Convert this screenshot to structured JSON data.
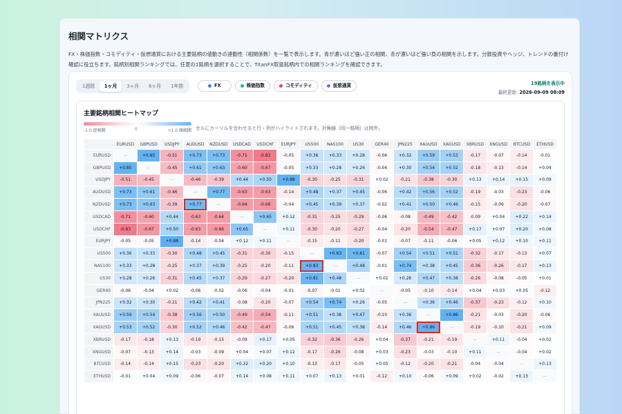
{
  "page": {
    "title": "相関マトリクス",
    "description": "FX・株価指数・コモディティ・仮想通貨における主要銘柄の値動きの連動性（相関係数）を一覧で表示します。青が濃いほど強い正の相関、赤が濃いほど強い負の相関を示します。分散投資やヘッジ、トレンドの裏付け確認に役立ちます。銘柄別相関ランキングでは、任意の1銘柄を選択することで、TitanFX取扱銘柄内での相関ランキングを確認できます。"
  },
  "periods": [
    {
      "label": "1週間",
      "active": false
    },
    {
      "label": "1ヶ月",
      "active": true
    },
    {
      "label": "3ヶ月",
      "active": false
    },
    {
      "label": "6ヶ月",
      "active": false
    },
    {
      "label": "1年間",
      "active": false
    }
  ],
  "categories": [
    {
      "label": "FX",
      "color": "#3b82f6"
    },
    {
      "label": "株価指数",
      "color": "#14b8a6"
    },
    {
      "label": "コモディティ",
      "color": "#ef4444"
    },
    {
      "label": "仮想通貨",
      "color": "#8b5cf6"
    }
  ],
  "meta": {
    "shown": "19銘柄を表示中",
    "updated_label": "最終更新:",
    "updated_value": "2026-09-09 08:09"
  },
  "heatmap": {
    "title": "主要銘柄相関ヒートマップ",
    "scale_min": "-1.0 逆相関",
    "scale_mid": "0",
    "scale_max": "+1.0 順相関",
    "hint": "セルにカーソルを合わせると行・列がハイライトされます。対角線（同一銘柄）は除外。",
    "diag": "—"
  },
  "chart_data": {
    "type": "heatmap",
    "colors": {
      "positive": "#5aaef0",
      "negative": "#ef6e7e",
      "highlight": "#dc2626"
    },
    "symbols": [
      "EURUSD",
      "GBPUSD",
      "USDJPY",
      "AUDUSD",
      "NZDUSD",
      "USDCAD",
      "USDCHF",
      "EURJPY",
      "US500",
      "NAS100",
      "US30",
      "GER40",
      "JPN225",
      "XAUUSD",
      "XAGUSD",
      "XBRUSD",
      "XNGUSD",
      "BTCUSD",
      "ETHUSD"
    ],
    "values": [
      [
        null,
        0.85,
        -0.51,
        0.73,
        0.73,
        -0.71,
        -0.83,
        -0.05,
        0.36,
        0.33,
        0.28,
        -0.06,
        0.32,
        0.59,
        0.53,
        -0.17,
        -0.07,
        -0.14,
        -0.01
      ],
      [
        0.85,
        null,
        -0.45,
        0.61,
        0.63,
        -0.6,
        -0.67,
        -0.05,
        0.33,
        0.28,
        0.26,
        -0.04,
        0.3,
        0.54,
        0.52,
        -0.18,
        -0.13,
        -0.14,
        0.04
      ],
      [
        -0.51,
        -0.45,
        null,
        -0.46,
        -0.39,
        0.44,
        0.5,
        0.88,
        -0.3,
        -0.25,
        -0.31,
        0.02,
        -0.21,
        -0.38,
        -0.3,
        0.13,
        0.14,
        0.15,
        0.09
      ],
      [
        0.73,
        0.61,
        -0.46,
        null,
        0.77,
        -0.63,
        -0.63,
        -0.14,
        0.48,
        0.37,
        0.45,
        -0.06,
        0.42,
        0.56,
        0.52,
        -0.19,
        -0.03,
        -0.23,
        -0.06
      ],
      [
        0.73,
        0.63,
        -0.39,
        0.77,
        null,
        -0.64,
        -0.66,
        -0.04,
        0.45,
        0.39,
        0.37,
        -0.02,
        0.41,
        0.5,
        0.46,
        -0.15,
        -0.09,
        -0.2,
        -0.07
      ],
      [
        -0.71,
        -0.6,
        0.44,
        -0.63,
        -0.64,
        null,
        0.65,
        0.12,
        -0.31,
        -0.25,
        -0.29,
        -0.06,
        -0.08,
        -0.49,
        -0.42,
        -0.09,
        0.04,
        0.22,
        0.14
      ],
      [
        -0.83,
        -0.67,
        0.5,
        -0.63,
        -0.66,
        0.65,
        null,
        0.11,
        -0.3,
        -0.2,
        -0.27,
        -0.04,
        -0.2,
        -0.54,
        -0.47,
        0.17,
        0.07,
        0.2,
        0.08
      ],
      [
        -0.05,
        -0.05,
        0.88,
        -0.14,
        -0.04,
        0.12,
        0.11,
        null,
        -0.15,
        -0.11,
        -0.2,
        -0.01,
        -0.07,
        -0.11,
        -0.06,
        0.05,
        0.12,
        0.1,
        0.11
      ],
      [
        0.36,
        0.33,
        -0.3,
        0.48,
        0.45,
        -0.31,
        -0.3,
        -0.15,
        null,
        0.83,
        0.81,
        -0.07,
        0.54,
        0.51,
        0.51,
        -0.32,
        -0.17,
        -0.13,
        0.07
      ],
      [
        0.33,
        0.28,
        -0.25,
        0.37,
        0.39,
        -0.25,
        -0.2,
        -0.11,
        0.83,
        null,
        0.48,
        -0.01,
        0.74,
        0.38,
        0.45,
        -0.36,
        -0.26,
        -0.17,
        0.13
      ],
      [
        0.28,
        0.26,
        -0.31,
        0.45,
        0.37,
        -0.29,
        -0.27,
        -0.2,
        0.81,
        0.48,
        null,
        0.02,
        0.26,
        0.47,
        0.38,
        -0.26,
        -0.08,
        -0.05,
        0.01
      ],
      [
        -0.06,
        -0.04,
        0.02,
        -0.06,
        -0.02,
        -0.06,
        -0.04,
        -0.01,
        -0.07,
        -0.01,
        0.02,
        null,
        -0.05,
        -0.1,
        -0.14,
        0.04,
        0.03,
        0.05,
        -0.12
      ],
      [
        0.32,
        0.3,
        -0.21,
        0.42,
        0.41,
        -0.08,
        -0.2,
        -0.07,
        0.54,
        0.74,
        0.26,
        -0.05,
        null,
        0.36,
        0.46,
        -0.37,
        -0.23,
        -0.12,
        0.1
      ],
      [
        0.59,
        0.54,
        -0.38,
        0.56,
        0.5,
        -0.49,
        -0.54,
        -0.11,
        0.51,
        0.38,
        0.47,
        -0.1,
        0.36,
        null,
        0.86,
        -0.21,
        -0.03,
        -0.2,
        -0.06
      ],
      [
        0.53,
        0.52,
        -0.3,
        0.52,
        0.46,
        -0.42,
        -0.47,
        -0.06,
        0.51,
        0.45,
        0.38,
        -0.14,
        0.46,
        0.86,
        null,
        -0.19,
        -0.1,
        -0.21,
        0.09
      ],
      [
        -0.17,
        -0.18,
        0.13,
        -0.19,
        -0.15,
        -0.09,
        0.17,
        0.05,
        -0.32,
        -0.36,
        -0.26,
        0.04,
        -0.37,
        -0.21,
        -0.19,
        null,
        0.11,
        -0.04,
        0.02
      ],
      [
        -0.07,
        -0.13,
        0.14,
        -0.03,
        -0.09,
        0.04,
        0.07,
        0.12,
        -0.17,
        -0.26,
        -0.08,
        0.03,
        -0.23,
        -0.03,
        -0.1,
        0.11,
        null,
        -0.04,
        0.02
      ],
      [
        -0.14,
        -0.14,
        0.15,
        -0.23,
        -0.2,
        0.22,
        0.2,
        0.1,
        -0.13,
        -0.17,
        -0.05,
        0.05,
        -0.12,
        -0.2,
        -0.21,
        -0.04,
        -0.04,
        null,
        0.13
      ],
      [
        -0.01,
        0.04,
        0.09,
        -0.06,
        -0.07,
        0.14,
        0.08,
        0.11,
        0.07,
        0.13,
        0.01,
        -0.12,
        0.1,
        -0.06,
        0.09,
        0.02,
        -0.02,
        0.13,
        null
      ]
    ],
    "highlighted": [
      [
        4,
        3
      ],
      [
        9,
        8
      ],
      [
        14,
        13
      ]
    ]
  }
}
